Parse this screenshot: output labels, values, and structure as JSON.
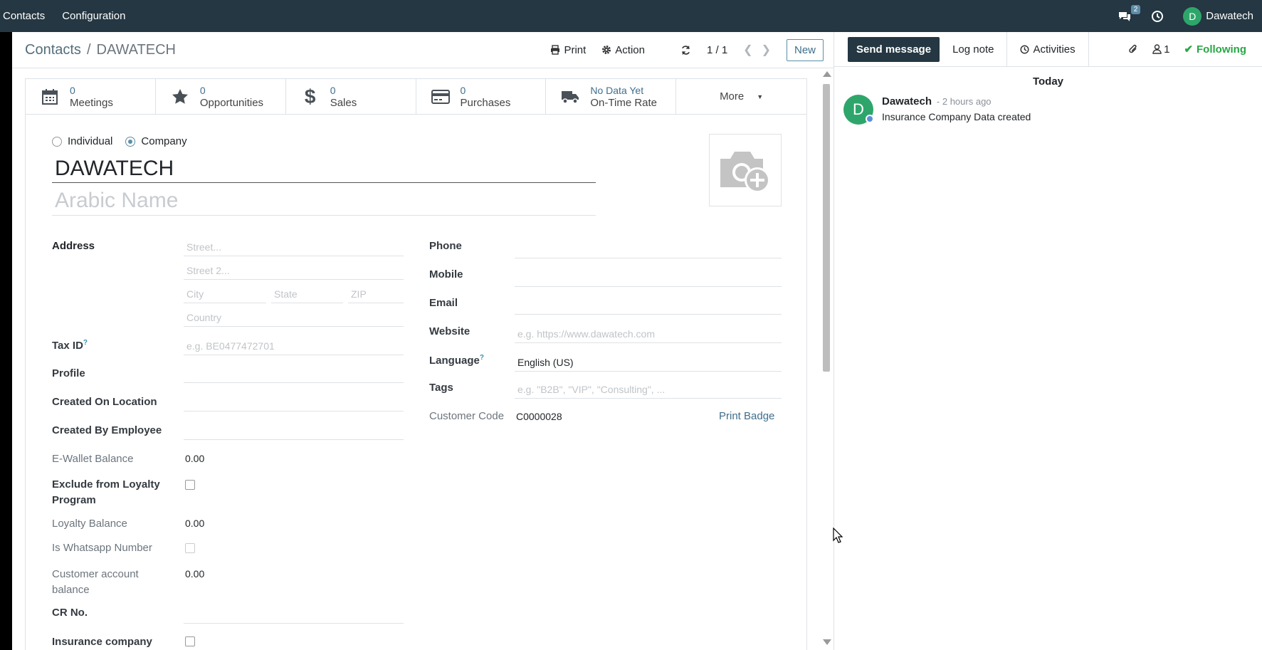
{
  "topbar": {
    "menus": [
      "Contacts",
      "Configuration"
    ],
    "messages_badge": "2",
    "user_initial": "D",
    "user_name": "Dawatech"
  },
  "breadcrumb": {
    "parent": "Contacts",
    "separator": "/",
    "current": "DAWATECH"
  },
  "control_panel": {
    "print_label": "Print",
    "action_label": "Action",
    "pager": "1 / 1",
    "new_label": "New"
  },
  "stat_buttons": [
    {
      "value": "0",
      "label": "Meetings",
      "icon": "calendar-icon"
    },
    {
      "value": "0",
      "label": "Opportunities",
      "icon": "star-icon"
    },
    {
      "value": "0",
      "label": "Sales",
      "icon": "dollar-icon"
    },
    {
      "value": "0",
      "label": "Purchases",
      "icon": "credit-card-icon"
    },
    {
      "value": "No Data Yet",
      "label": "On-Time Rate",
      "icon": "truck-icon"
    }
  ],
  "more_label": "More",
  "company_type": {
    "individual": "Individual",
    "company": "Company",
    "selected": "Company"
  },
  "name": "DAWATECH",
  "arabic_name_placeholder": "Arabic Name",
  "address": {
    "label": "Address",
    "street_placeholder": "Street...",
    "street2_placeholder": "Street 2...",
    "city_placeholder": "City",
    "state_placeholder": "State",
    "zip_placeholder": "ZIP",
    "country_placeholder": "Country"
  },
  "left_fields": {
    "tax_id_label": "Tax ID",
    "tax_id_placeholder": "e.g. BE0477472701",
    "profile_label": "Profile",
    "created_on_location_label": "Created On Location",
    "created_by_employee_label": "Created By Employee",
    "ewallet_label": "E-Wallet Balance",
    "ewallet_value": "0.00",
    "exclude_loyalty_label_1": "Exclude from Loyalty",
    "exclude_loyalty_label_2": "Program",
    "loyalty_balance_label": "Loyalty Balance",
    "loyalty_balance_value": "0.00",
    "whatsapp_label": "Is Whatsapp Number",
    "customer_balance_label_1": "Customer account",
    "customer_balance_label_2": "balance",
    "customer_balance_value": "0.00",
    "cr_no_label": "CR No.",
    "insurance_label": "Insurance company"
  },
  "right_fields": {
    "phone_label": "Phone",
    "mobile_label": "Mobile",
    "email_label": "Email",
    "website_label": "Website",
    "website_placeholder": "e.g. https://www.dawatech.com",
    "language_label": "Language",
    "language_value": "English (US)",
    "tags_label": "Tags",
    "tags_placeholder": "e.g. \"B2B\", \"VIP\", \"Consulting\", ...",
    "customer_code_label": "Customer Code",
    "customer_code_value": "C0000028",
    "print_badge_label": "Print Badge"
  },
  "tooltip_mark": "?",
  "chatter": {
    "send_message": "Send message",
    "log_note": "Log note",
    "activities": "Activities",
    "followers_count": "1",
    "following": "Following",
    "date_separator": "Today",
    "messages": [
      {
        "initial": "D",
        "author": "Dawatech",
        "time": "- 2 hours ago",
        "body": "Insurance Company Data created"
      }
    ]
  },
  "colors": {
    "navbar": "#243742",
    "link": "#3f6f8c",
    "avatar": "#2ea66b",
    "following": "#28a745"
  }
}
